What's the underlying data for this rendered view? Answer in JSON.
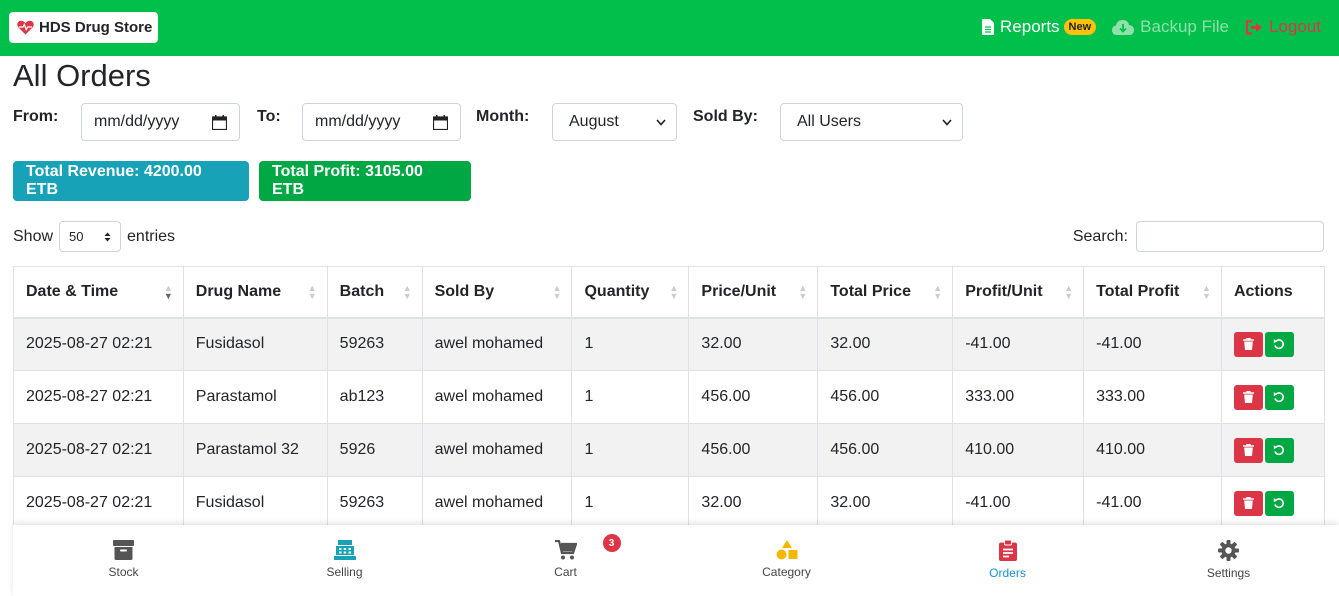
{
  "app": {
    "brand": "HDS Drug Store",
    "nav": {
      "reports": "Reports",
      "reports_badge": "New",
      "backup": "Backup File",
      "logout": "Logout"
    }
  },
  "page": {
    "title": "All Orders"
  },
  "filters": {
    "from_label": "From:",
    "from_value": "mm/dd/yyyy",
    "to_label": "To:",
    "to_value": "mm/dd/yyyy",
    "month_label": "Month:",
    "month_value": "August",
    "soldby_label": "Sold By:",
    "soldby_value": "All Users"
  },
  "stats": {
    "revenue": "Total Revenue: 4200.00 ETB",
    "profit": "Total Profit: 3105.00 ETB"
  },
  "table_controls": {
    "show": "Show",
    "entries_value": "50",
    "entries": "entries",
    "search": "Search:"
  },
  "table": {
    "headers": [
      "Date & Time",
      "Drug Name",
      "Batch",
      "Sold By",
      "Quantity",
      "Price/Unit",
      "Total Price",
      "Profit/Unit",
      "Total Profit",
      "Actions"
    ],
    "rows": [
      [
        "2025-08-27 02:21",
        "Fusidasol",
        "59263",
        "awel mohamed",
        "1",
        "32.00",
        "32.00",
        "-41.00",
        "-41.00"
      ],
      [
        "2025-08-27 02:21",
        "Parastamol",
        "ab123",
        "awel mohamed",
        "1",
        "456.00",
        "456.00",
        "333.00",
        "333.00"
      ],
      [
        "2025-08-27 02:21",
        "Parastamol 32",
        "5926",
        "awel mohamed",
        "1",
        "456.00",
        "456.00",
        "410.00",
        "410.00"
      ],
      [
        "2025-08-27 02:21",
        "Fusidasol",
        "59263",
        "awel mohamed",
        "1",
        "32.00",
        "32.00",
        "-41.00",
        "-41.00"
      ]
    ]
  },
  "bottom_nav": {
    "items": [
      {
        "label": "Stock",
        "icon": "archive-icon"
      },
      {
        "label": "Selling",
        "icon": "cash-register-icon"
      },
      {
        "label": "Cart",
        "icon": "cart-icon",
        "badge": "3"
      },
      {
        "label": "Category",
        "icon": "shapes-icon"
      },
      {
        "label": "Orders",
        "icon": "clipboard-icon",
        "active": true
      },
      {
        "label": "Settings",
        "icon": "gear-icon"
      }
    ]
  },
  "colors": {
    "topbar": "#00c04b",
    "revenue": "#17a2b8",
    "profit": "#00a843",
    "danger": "#dc3545",
    "active_nav": "#1a8fd6"
  }
}
